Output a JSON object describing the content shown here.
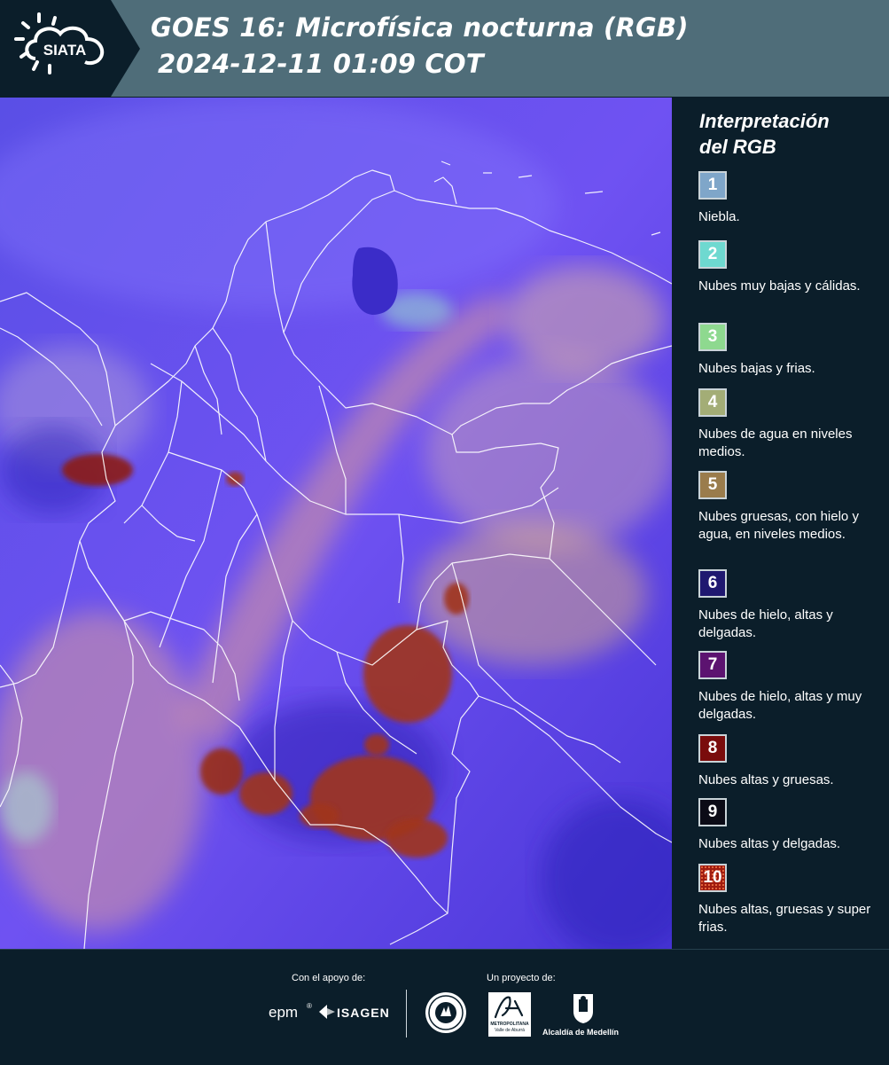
{
  "header": {
    "logo_text": "SIATA",
    "title_line1": "GOES 16: Microfísica nocturna (RGB)",
    "title_line2": "2024-12-11 01:09 COT",
    "background_color": "#4f6d79"
  },
  "map": {
    "description_icon": "satellite-rgb-map",
    "base_color": "#6a4cf0",
    "border_color": "#ffffff"
  },
  "legend": {
    "title_line1": "Interpretación",
    "title_line2": "del RGB",
    "items": [
      {
        "number": "1",
        "label": "Niebla.",
        "color": "#7fa6c9"
      },
      {
        "number": "2",
        "label": "Nubes muy bajas y cálidas.",
        "color": "#6ed9d0"
      },
      {
        "number": "3",
        "label": "Nubes bajas y frias.",
        "color": "#8ed98f"
      },
      {
        "number": "4",
        "label": "Nubes de agua en niveles medios.",
        "color": "#a3ad76"
      },
      {
        "number": "5",
        "label": "Nubes gruesas, con hielo y agua, en niveles medios.",
        "color": "#9a7c4c"
      },
      {
        "number": "6",
        "label": "Nubes de hielo, altas y delgadas.",
        "color": "#1f1870"
      },
      {
        "number": "7",
        "label": "Nubes de hielo, altas y muy delgadas.",
        "color": "#5c1370"
      },
      {
        "number": "8",
        "label": "Nubes altas y gruesas.",
        "color": "#7a0c0c"
      },
      {
        "number": "9",
        "label": "Nubes altas y delgadas.",
        "color": "#0b0b16"
      },
      {
        "number": "10",
        "label": "Nubes altas, gruesas y super frias.",
        "color": "#a01c10"
      }
    ]
  },
  "footer": {
    "support_label": "Con el apoyo de:",
    "project_label": "Un proyecto de:",
    "sponsor1": "epm",
    "sponsor2": "ISAGEN",
    "partner1": "METROPOLITANA",
    "partner1_sub": "Valle de Aburrá",
    "partner2": "Alcaldía de Medellín"
  }
}
